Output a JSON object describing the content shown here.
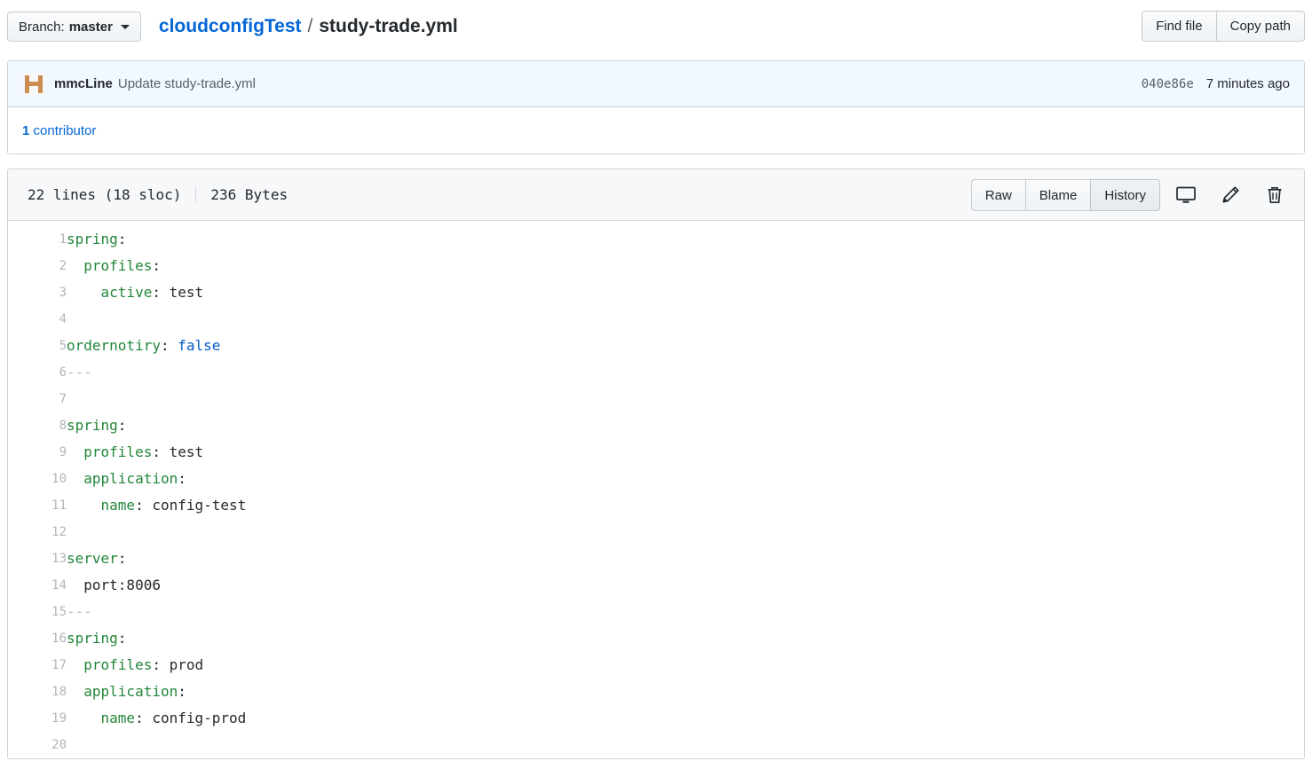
{
  "topbar": {
    "branch_prefix": "Branch:",
    "branch_name": "master",
    "branch_caret_icon": "chevron-down-icon",
    "repo_name": "cloudconfigTest",
    "path_separator": "/",
    "file_name": "study-trade.yml",
    "find_file_label": "Find file",
    "copy_path_label": "Copy path"
  },
  "commit": {
    "avatar_icon": "user-avatar",
    "author": "mmcLine",
    "message": "Update study-trade.yml",
    "sha": "040e86e",
    "time": "7 minutes ago"
  },
  "contributors": {
    "count": "1",
    "label": "contributor",
    "full": "1 contributor"
  },
  "file_header": {
    "lines": "22 lines (18 sloc)",
    "size": "236 Bytes",
    "raw_label": "Raw",
    "blame_label": "Blame",
    "history_label": "History",
    "desktop_icon": "desktop-icon",
    "edit_icon": "pencil-icon",
    "delete_icon": "trash-icon"
  },
  "code": {
    "language": "yaml",
    "lines": [
      {
        "n": "1",
        "tokens": [
          {
            "t": "spring",
            "c": "k"
          },
          {
            "t": ":",
            "c": "p"
          }
        ]
      },
      {
        "n": "2",
        "tokens": [
          {
            "t": "  ",
            "c": "p"
          },
          {
            "t": "profiles",
            "c": "k"
          },
          {
            "t": ":",
            "c": "p"
          }
        ]
      },
      {
        "n": "3",
        "tokens": [
          {
            "t": "    ",
            "c": "p"
          },
          {
            "t": "active",
            "c": "k"
          },
          {
            "t": ": ",
            "c": "p"
          },
          {
            "t": "test",
            "c": "v"
          }
        ]
      },
      {
        "n": "4",
        "tokens": []
      },
      {
        "n": "5",
        "tokens": [
          {
            "t": "ordernotiry",
            "c": "k"
          },
          {
            "t": ": ",
            "c": "p"
          },
          {
            "t": "false",
            "c": "c"
          }
        ]
      },
      {
        "n": "6",
        "tokens": [
          {
            "t": "---",
            "c": "d"
          }
        ]
      },
      {
        "n": "7",
        "tokens": []
      },
      {
        "n": "8",
        "tokens": [
          {
            "t": "spring",
            "c": "k"
          },
          {
            "t": ":",
            "c": "p"
          }
        ]
      },
      {
        "n": "9",
        "tokens": [
          {
            "t": "  ",
            "c": "p"
          },
          {
            "t": "profiles",
            "c": "k"
          },
          {
            "t": ": ",
            "c": "p"
          },
          {
            "t": "test",
            "c": "v"
          }
        ]
      },
      {
        "n": "10",
        "tokens": [
          {
            "t": "  ",
            "c": "p"
          },
          {
            "t": "application",
            "c": "k"
          },
          {
            "t": ":",
            "c": "p"
          }
        ]
      },
      {
        "n": "11",
        "tokens": [
          {
            "t": "    ",
            "c": "p"
          },
          {
            "t": "name",
            "c": "k"
          },
          {
            "t": ": ",
            "c": "p"
          },
          {
            "t": "config-test",
            "c": "v"
          }
        ]
      },
      {
        "n": "12",
        "tokens": []
      },
      {
        "n": "13",
        "tokens": [
          {
            "t": "server",
            "c": "k"
          },
          {
            "t": ":",
            "c": "p"
          }
        ]
      },
      {
        "n": "14",
        "tokens": [
          {
            "t": "  ",
            "c": "p"
          },
          {
            "t": "port:8006",
            "c": "v"
          }
        ]
      },
      {
        "n": "15",
        "tokens": [
          {
            "t": "---",
            "c": "d"
          }
        ]
      },
      {
        "n": "16",
        "tokens": [
          {
            "t": "spring",
            "c": "k"
          },
          {
            "t": ":",
            "c": "p"
          }
        ]
      },
      {
        "n": "17",
        "tokens": [
          {
            "t": "  ",
            "c": "p"
          },
          {
            "t": "profiles",
            "c": "k"
          },
          {
            "t": ": ",
            "c": "p"
          },
          {
            "t": "prod",
            "c": "v"
          }
        ]
      },
      {
        "n": "18",
        "tokens": [
          {
            "t": "  ",
            "c": "p"
          },
          {
            "t": "application",
            "c": "k"
          },
          {
            "t": ":",
            "c": "p"
          }
        ]
      },
      {
        "n": "19",
        "tokens": [
          {
            "t": "    ",
            "c": "p"
          },
          {
            "t": "name",
            "c": "k"
          },
          {
            "t": ": ",
            "c": "p"
          },
          {
            "t": "config-prod",
            "c": "v"
          }
        ]
      },
      {
        "n": "20",
        "tokens": []
      }
    ]
  },
  "colors": {
    "link": "#0366d6",
    "key": "#22863a",
    "constant": "#005cc5",
    "text": "#24292e",
    "muted": "#586069",
    "commit_bg": "#f1f8ff",
    "header_bg": "#f6f8fa",
    "border": "#d1d5da",
    "avatar": "#cd8c52"
  }
}
